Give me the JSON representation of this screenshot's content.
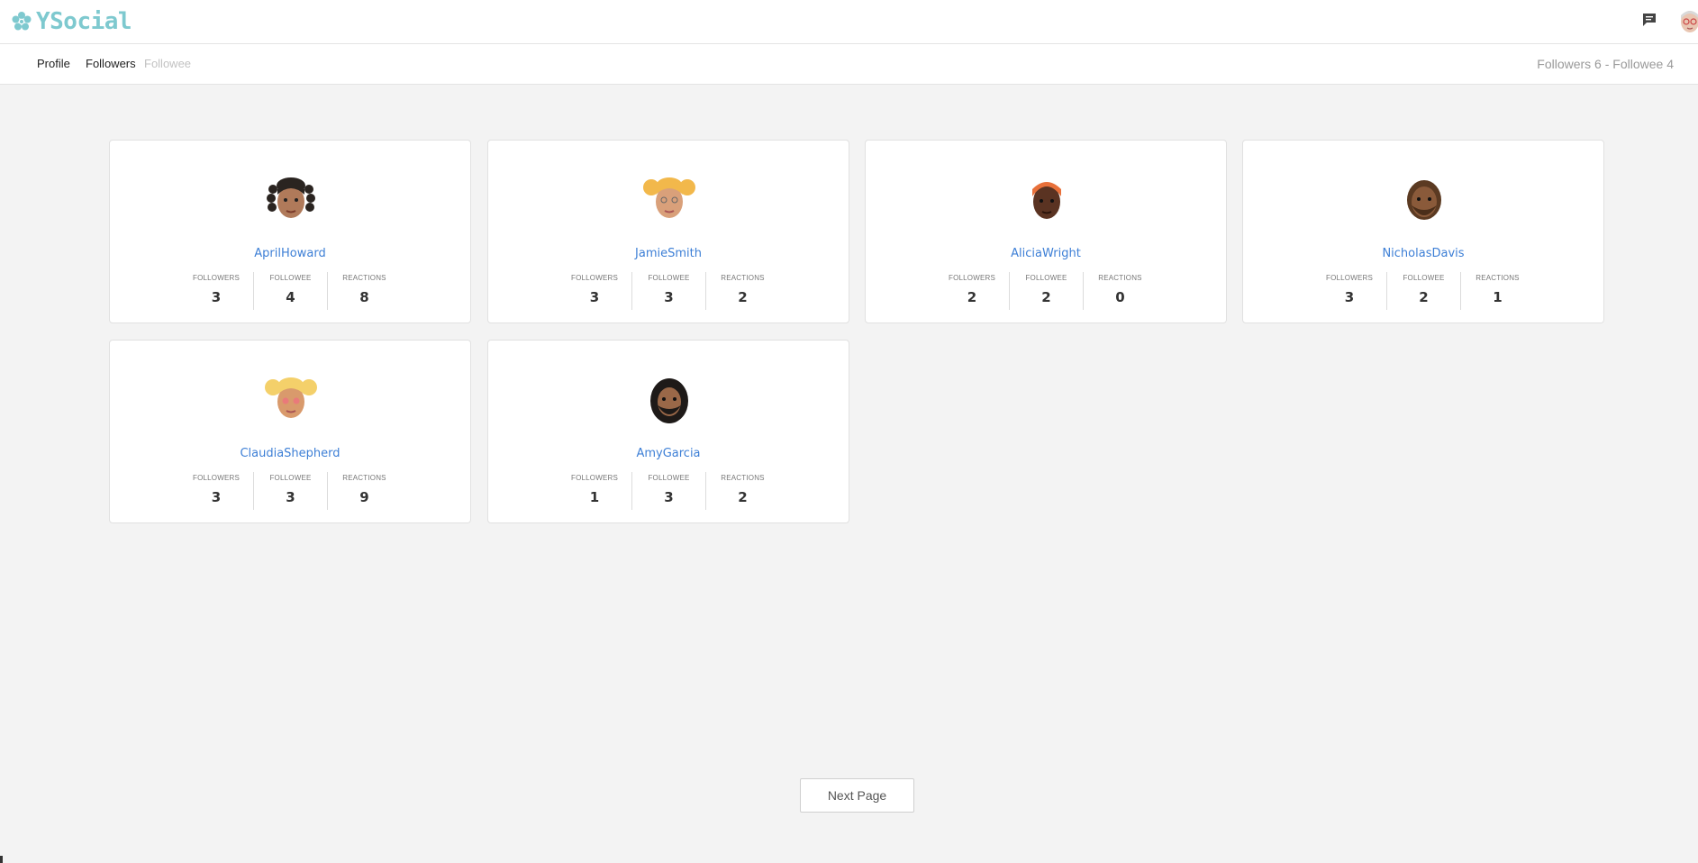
{
  "header": {
    "brand": "YSocial",
    "icons": [
      "flower-logo-icon",
      "chat-icon",
      "user-avatar"
    ]
  },
  "subnav": {
    "tabs": [
      {
        "label": "Profile"
      },
      {
        "label": "Followers"
      },
      {
        "label": "Followee"
      }
    ],
    "counts": "Followers 6 - Followee 4"
  },
  "stat_labels": {
    "followers": "FOLLOWERS",
    "followee": "FOLLOWEE",
    "reactions": "REACTIONS"
  },
  "users": [
    {
      "name": "AprilHoward",
      "followers": "3",
      "followee": "4",
      "reactions": "8"
    },
    {
      "name": "JamieSmith",
      "followers": "3",
      "followee": "3",
      "reactions": "2"
    },
    {
      "name": "AliciaWright",
      "followers": "2",
      "followee": "2",
      "reactions": "0"
    },
    {
      "name": "NicholasDavis",
      "followers": "3",
      "followee": "2",
      "reactions": "1"
    },
    {
      "name": "ClaudiaShepherd",
      "followers": "3",
      "followee": "3",
      "reactions": "9"
    },
    {
      "name": "AmyGarcia",
      "followers": "1",
      "followee": "3",
      "reactions": "2"
    }
  ],
  "pagination": {
    "next_label": "Next Page"
  },
  "colors": {
    "brand": "#7ec9cf",
    "link": "#3d7fd6",
    "background": "#f3f3f3"
  }
}
